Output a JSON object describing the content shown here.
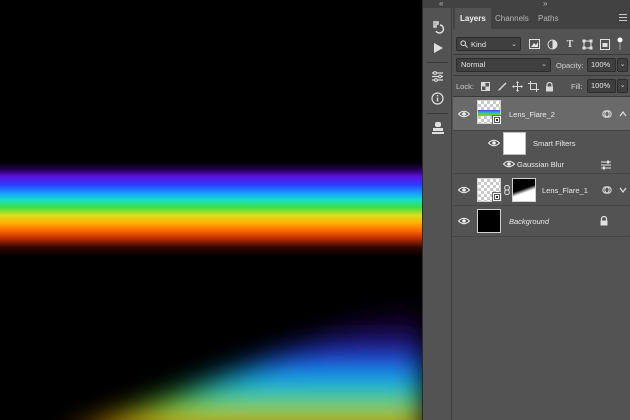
{
  "panel": {
    "tabs": [
      {
        "label": "Layers",
        "active": true
      },
      {
        "label": "Channels",
        "active": false
      },
      {
        "label": "Paths",
        "active": false
      }
    ],
    "filter_kind": "Kind",
    "blend_mode": "Normal",
    "opacity_label": "Opacity:",
    "opacity_value": "100%",
    "lock_label": "Lock:",
    "fill_label": "Fill:",
    "fill_value": "100%"
  },
  "layers": [
    {
      "name": "Lens_Flare_2",
      "selected": true,
      "type": "smart-object"
    },
    {
      "name": "Smart Filters",
      "type": "smart-filters"
    },
    {
      "name": "Gaussian Blur",
      "type": "filter"
    },
    {
      "name": "Lens_Flare_1",
      "type": "smart-object-with-mask"
    },
    {
      "name": "Background",
      "type": "background",
      "locked": true
    }
  ],
  "icons": {
    "toolstrip": [
      "history-icon",
      "play-action-icon",
      "adjustments-icon",
      "info-icon",
      "clone-source-icon"
    ],
    "filters": [
      "pixel-filter-icon",
      "adjustment-filter-icon",
      "type-filter-icon",
      "shape-filter-icon",
      "smart-object-filter-icon"
    ],
    "locks": [
      "lock-transparent-icon",
      "lock-paint-icon",
      "lock-position-icon",
      "lock-artboard-icon",
      "lock-all-icon"
    ]
  },
  "colors": {
    "panel_bg": "#535353",
    "selected_row": "#6a6a6a",
    "canvas_bg": "#000000"
  }
}
